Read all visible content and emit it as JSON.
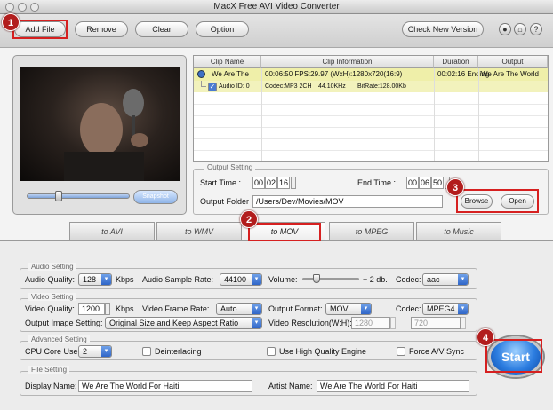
{
  "window": {
    "title": "MacX Free AVI Video Converter"
  },
  "toolbar": {
    "add_file": "Add File",
    "remove": "Remove",
    "clear": "Clear",
    "option": "Option",
    "check_new_version": "Check New Version"
  },
  "badges": [
    "1",
    "2",
    "3",
    "4"
  ],
  "preview": {
    "snapshot": "Snapshot"
  },
  "table": {
    "headers": [
      "Clip Name",
      "Clip Information",
      "Duration",
      "Output"
    ],
    "clip": {
      "name": "We Are The",
      "info": "00:06:50  FPS:29.97  (WxH):1280x720(16:9)",
      "duration": "00:02:16 Ending",
      "output": "We Are The World"
    },
    "audio": {
      "label": "Audio ID: 0",
      "codec": "Codec:MP3 2CH",
      "rate": "44.10KHz",
      "bitrate": "BitRate:128.00Kb"
    }
  },
  "output_setting": {
    "legend": "Output Setting",
    "start_time_label": "Start Time :",
    "start_time": [
      "00",
      "02",
      "16"
    ],
    "end_time_label": "End Time :",
    "end_time": [
      "00",
      "06",
      "50"
    ],
    "output_folder_label": "Output Folder :",
    "output_folder": "/Users/Dev/Movies/MOV",
    "browse": "Browse",
    "open": "Open"
  },
  "tabs": [
    "to AVI",
    "to WMV",
    "to MOV",
    "to MPEG",
    "to Music"
  ],
  "audio_setting": {
    "legend": "Audio Setting",
    "quality_label": "Audio Quality:",
    "quality": "128",
    "kbps": "Kbps",
    "sample_rate_label": "Audio Sample Rate:",
    "sample_rate": "44100",
    "volume_label": "Volume:",
    "volume_value": "+ 2 db.",
    "codec_label": "Codec:",
    "codec": "aac"
  },
  "video_setting": {
    "legend": "Video Setting",
    "quality_label": "Video Quality:",
    "quality": "1200",
    "kbps": "Kbps",
    "frame_rate_label": "Video Frame Rate:",
    "frame_rate": "Auto",
    "output_format_label": "Output Format:",
    "output_format": "MOV",
    "codec_label": "Codec:",
    "codec": "MPEG4",
    "image_setting_label": "Output Image Setting:",
    "image_setting": "Original Size and Keep Aspect Ratio",
    "resolution_label": "Video Resolution(W:H):",
    "res_w": "1280",
    "res_h": "720"
  },
  "advanced_setting": {
    "legend": "Advanced Setting",
    "cpu_label": "CPU Core Use:",
    "cpu": "2",
    "deinterlacing": "Deinterlacing",
    "high_quality": "Use High Quality Engine",
    "force_av_sync": "Force A/V Sync"
  },
  "file_setting": {
    "legend": "File Setting",
    "display_name_label": "Display Name:",
    "display_name": "We Are The World For Haiti",
    "artist_name_label": "Artist Name:",
    "artist_name": "We Are The World For Haiti"
  },
  "start": "Start"
}
